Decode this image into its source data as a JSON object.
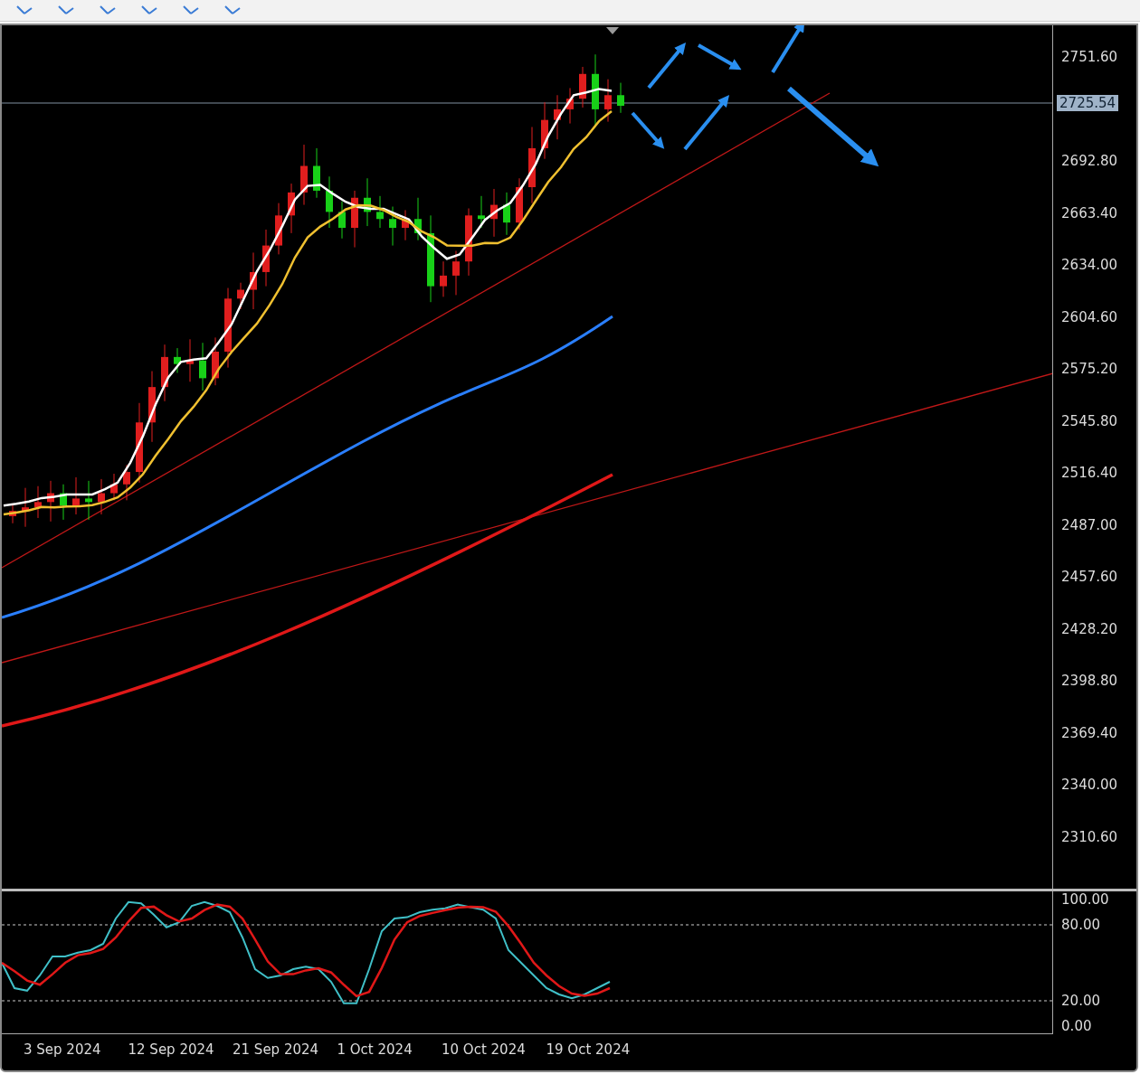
{
  "price_chart": {
    "price_axis": [
      "2751.60",
      "2692.80",
      "2663.40",
      "2634.00",
      "2604.60",
      "2575.20",
      "2545.80",
      "2516.40",
      "2487.00",
      "2457.60",
      "2428.20",
      "2398.80",
      "2369.40",
      "2340.00",
      "2310.60"
    ],
    "current_price": "2725.54"
  },
  "indicator": {
    "levels": [
      "100.00",
      "80.00",
      "20.00",
      "0.00"
    ]
  },
  "time_axis": [
    "3 Sep 2024",
    "12 Sep 2024",
    "21 Sep 2024",
    "1 Oct 2024",
    "10 Oct 2024",
    "19 Oct 2024"
  ]
}
